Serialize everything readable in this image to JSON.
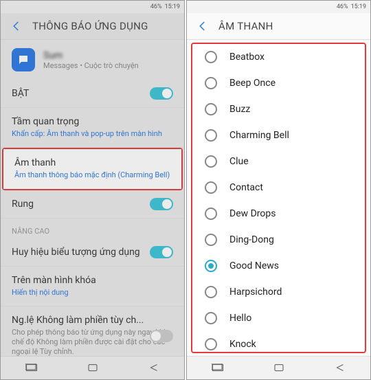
{
  "status": {
    "battery": "46%",
    "time": "15:19"
  },
  "left": {
    "title": "THÔNG BÁO ỨNG DỤNG",
    "app": {
      "name_blur": "Sum",
      "sub": "Messages • Cuộc trò chuyện"
    },
    "on_label": "BẬT",
    "importance": {
      "label": "Tầm quan trọng",
      "sub": "Khẩn cấp: Âm thanh và pop-up trên màn hình"
    },
    "sound": {
      "label": "Âm thanh",
      "sub": "Âm thanh thông báo mặc định (Charming Bell)"
    },
    "vibrate": {
      "label": "Rung"
    },
    "adv_header": "NÂNG CAO",
    "badge": {
      "label": "Huy hiệu biểu tượng ứng dụng"
    },
    "lock": {
      "label": "Trên màn hình khóa",
      "sub": "Hiển thị nội dung"
    },
    "dnd": {
      "label": "Ng.lệ Không làm phiền tùy ch...",
      "sub": "Cho phép thông báo từ ứng dụng này ngay khi chế độ Không làm phiền được cài đặt cho các ngoại lệ Tùy chỉnh."
    }
  },
  "right": {
    "title": "ÂM THANH",
    "options": [
      "Beatbox",
      "Beep Once",
      "Buzz",
      "Charming Bell",
      "Clue",
      "Contact",
      "Dew Drops",
      "Ding-Dong",
      "Good News",
      "Harpsichord",
      "Hello",
      "Knock"
    ],
    "selected": "Good News"
  },
  "chart_data": null
}
